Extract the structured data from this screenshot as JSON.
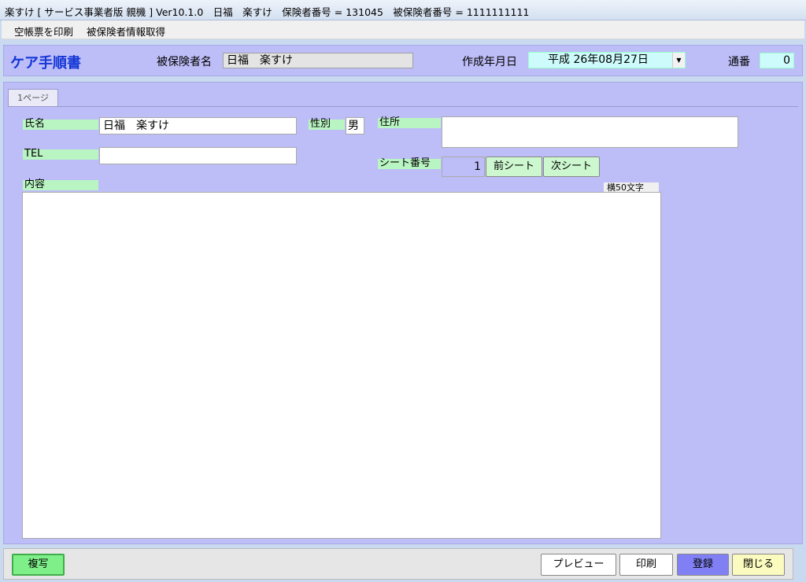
{
  "window": {
    "title": "楽すけ [ サービス事業者版 親機 ] Ver10.1.0　日福　楽すけ　保険者番号 = 131045　被保険者番号 = 1111111111"
  },
  "menu": {
    "items": [
      "空帳票を印刷",
      "被保険者情報取得"
    ]
  },
  "header": {
    "title": "ケア手順書",
    "insured_label": "被保険者名",
    "insured_value": "日福　楽すけ",
    "created_label": "作成年月日",
    "created_value": "平成 26年08月27日",
    "serial_label": "通番",
    "serial_value": "0"
  },
  "tabs": [
    "1ページ"
  ],
  "form": {
    "name_label": "氏名",
    "name_value": "日福　楽すけ",
    "gender_label": "性別",
    "gender_value": "男",
    "address_label": "住所",
    "address_value": "",
    "tel_label": "TEL",
    "tel_value": "",
    "sheet_label": "シート番号",
    "sheet_value": "1",
    "prev_sheet": "前シート",
    "next_sheet": "次シート",
    "content_label": "内容",
    "content_hint": "横50文字",
    "content_value": ""
  },
  "footer": {
    "copy": "複写",
    "preview": "プレビュー",
    "print": "印刷",
    "register": "登録",
    "close": "閉じる"
  },
  "colors": {
    "panel": "#bdbdf7",
    "label_bg": "#b9f5c2",
    "date_bg": "#cdfafa",
    "title": "#1437d6",
    "register_bg": "#8080f4",
    "close_bg": "#fbfbbf",
    "copy_bg": "#7fef8a"
  }
}
